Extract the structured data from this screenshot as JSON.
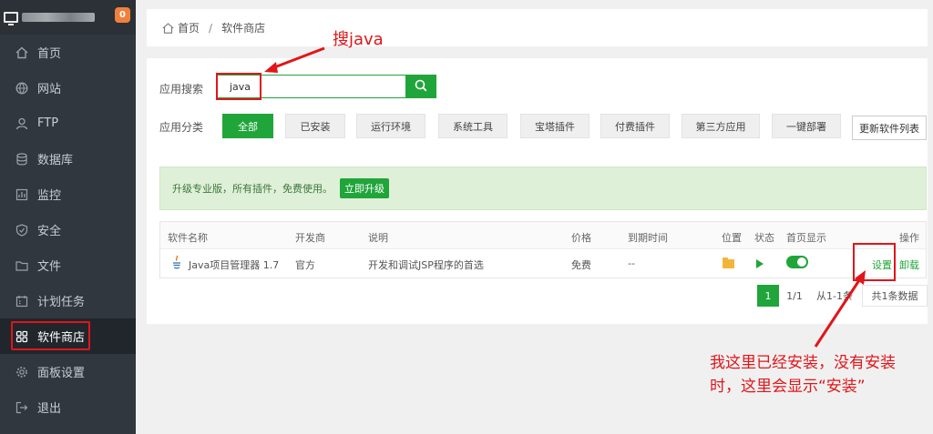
{
  "sidebar": {
    "badge": "0",
    "items": [
      {
        "label": "首页",
        "icon": "home-icon"
      },
      {
        "label": "网站",
        "icon": "globe-icon"
      },
      {
        "label": "FTP",
        "icon": "ftp-icon"
      },
      {
        "label": "数据库",
        "icon": "database-icon"
      },
      {
        "label": "监控",
        "icon": "monitor-icon"
      },
      {
        "label": "安全",
        "icon": "shield-icon"
      },
      {
        "label": "文件",
        "icon": "folder-icon"
      },
      {
        "label": "计划任务",
        "icon": "calendar-icon"
      },
      {
        "label": "软件商店",
        "icon": "grid-icon",
        "active": true
      },
      {
        "label": "面板设置",
        "icon": "gear-icon"
      },
      {
        "label": "退出",
        "icon": "logout-icon"
      }
    ]
  },
  "breadcrumb": {
    "home": "首页",
    "separator": "/",
    "current": "软件商店"
  },
  "search": {
    "label": "应用搜索",
    "value": "java"
  },
  "category": {
    "label": "应用分类",
    "options": [
      "全部",
      "已安装",
      "运行环境",
      "系统工具",
      "宝塔插件",
      "付费插件",
      "第三方应用",
      "一键部署"
    ],
    "selected": "全部",
    "refresh_label": "更新软件列表"
  },
  "promo": {
    "text": "升级专业版，所有插件，免费使用。",
    "button": "立即升级"
  },
  "table": {
    "columns": [
      "软件名称",
      "开发商",
      "说明",
      "价格",
      "到期时间",
      "位置",
      "状态",
      "首页显示",
      "操作"
    ],
    "rows": [
      {
        "name": "Java项目管理器 1.7",
        "developer": "官方",
        "description": "开发和调试JSP程序的首选",
        "price": "免费",
        "expiry": "--",
        "homepage_display": true,
        "actions": [
          "设置",
          "卸载"
        ]
      }
    ]
  },
  "pagination": {
    "current": "1",
    "pages": "1/1",
    "range": "从1-1条",
    "total": "共1条数据"
  },
  "annotations": {
    "search_note": "搜java",
    "install_note": "我这里已经安装，没有安装时，这里会显示“安装”"
  },
  "colors": {
    "accent": "#20a53a",
    "annotation": "#e0161b",
    "sidebar": "#30373e"
  }
}
